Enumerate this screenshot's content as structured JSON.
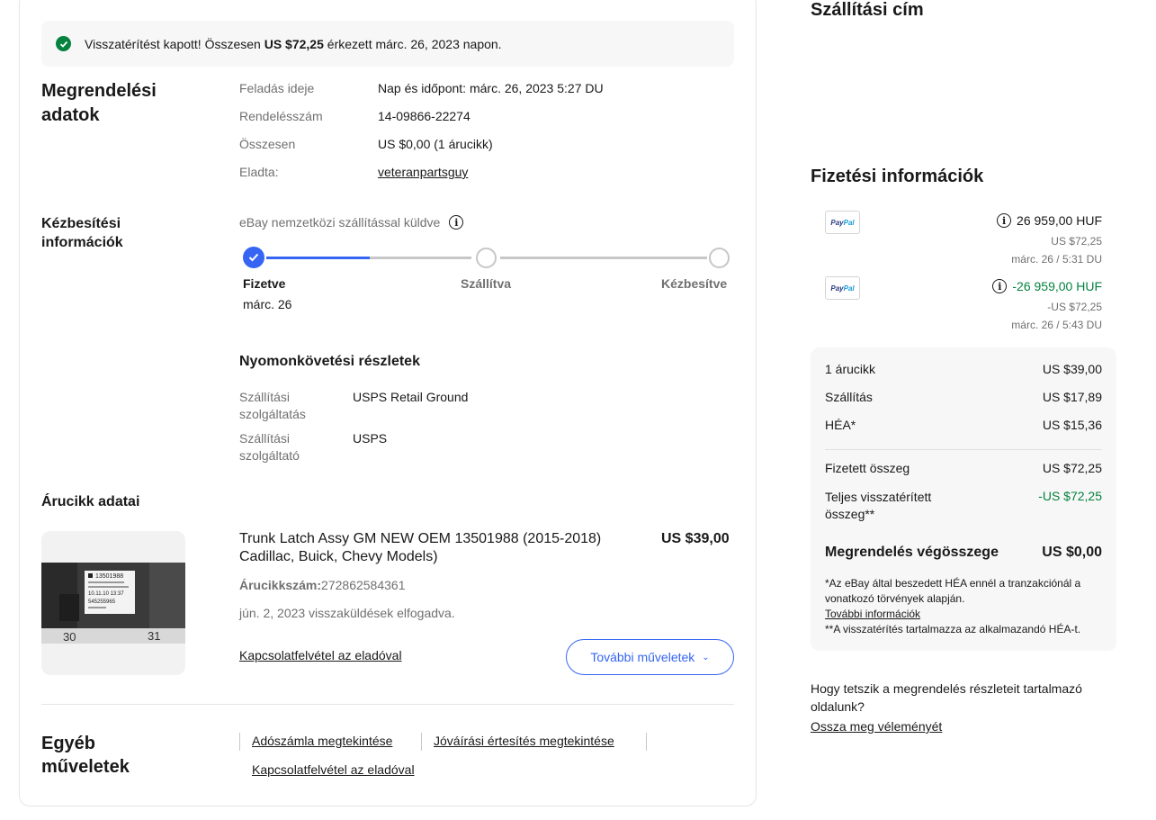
{
  "banner": {
    "text_before": "Visszatérítést kapott! Összesen ",
    "amount": "US $72,25",
    "text_after": " érkezett márc. 26, 2023 napon."
  },
  "order": {
    "title": "Megrendelési adatok",
    "rows": [
      {
        "label": "Feladás ideje",
        "value": "Nap és időpont: márc. 26, 2023 5:27 DU"
      },
      {
        "label": "Rendelésszám",
        "value": "14-09866-22274"
      },
      {
        "label": "Összesen",
        "value": "US $0,00 (1 árucikk)"
      },
      {
        "label": "Eladta:",
        "value": "veteranpartsguy"
      }
    ]
  },
  "delivery": {
    "title": "Kézbesítési információk",
    "note": "eBay nemzetközi szállítással küldve",
    "progress_fraction": 0.23,
    "steps": [
      {
        "label": "Fizetve",
        "date": "márc. 26"
      },
      {
        "label": "Szállítva"
      },
      {
        "label": "Kézbesítve"
      }
    ],
    "tracking": {
      "title": "Nyomonkövetési részletek",
      "rows": [
        {
          "label": "Szállítási szolgáltatás",
          "value": "USPS Retail Ground"
        },
        {
          "label": "Szállítási szolgáltató",
          "value": "USPS"
        }
      ]
    }
  },
  "item": {
    "section_title": "Árucikk adatai",
    "title": "Trunk Latch Assy GM NEW OEM 13501988 (2015-2018) Cadillac, Buick, Chevy Models)",
    "price": "US $39,00",
    "number_label": "Árucikkszám:",
    "number": "272862584361",
    "return_note": "jún. 2, 2023 visszaküldések elfogadva.",
    "contact_link": "Kapcsolatfelvétel az eladóval",
    "more_button": "További műveletek",
    "image_label_lines": [
      "13501988",
      "10.11.10 13:37",
      "545255965"
    ],
    "image_corner_numbers": [
      "30",
      "31"
    ]
  },
  "other": {
    "title": "Egyéb műveletek",
    "links": [
      "Adószámla megtekintése",
      "Jóváírási értesítés megtekintése",
      "Kapcsolatfelvétel az eladóval"
    ]
  },
  "shipping_address": {
    "title": "Szállítási cím"
  },
  "payment": {
    "title": "Fizetési információk",
    "brand_a": "Pay",
    "brand_b": "Pal",
    "entries": [
      {
        "amount": "26 959,00 HUF",
        "usd": "US $72,25",
        "date": "márc. 26 / 5:31 DU"
      },
      {
        "amount": "-26 959,00 HUF",
        "usd": "-US $72,25",
        "date": "márc. 26 / 5:43 DU"
      }
    ]
  },
  "summary": {
    "rows": [
      {
        "label": "1 árucikk",
        "value": "US $39,00"
      },
      {
        "label": "Szállítás",
        "value": "US $17,89"
      },
      {
        "label": "HÉA*",
        "value": "US $15,36"
      }
    ],
    "paid_label": "Fizetett összeg",
    "paid_value": "US $72,25",
    "refund_label": "Teljes visszatérített összeg**",
    "refund_value": "-US $72,25",
    "total_label": "Megrendelés végösszege",
    "total_value": "US $0,00",
    "note1": "*Az eBay által beszedett HÉA ennél a tranzakciónál a vonatkozó törvények alapján.",
    "more_info": "További információk",
    "note2": "**A visszatérítés tartalmazza az alkalmazandó HÉA-t."
  },
  "feedback": {
    "question": "Hogy tetszik a megrendelés részleteit tartalmazó oldalunk?",
    "link": "Ossza meg véleményét"
  },
  "colors": {
    "accent": "#3665f3",
    "success": "#05823f",
    "muted": "#707070"
  }
}
